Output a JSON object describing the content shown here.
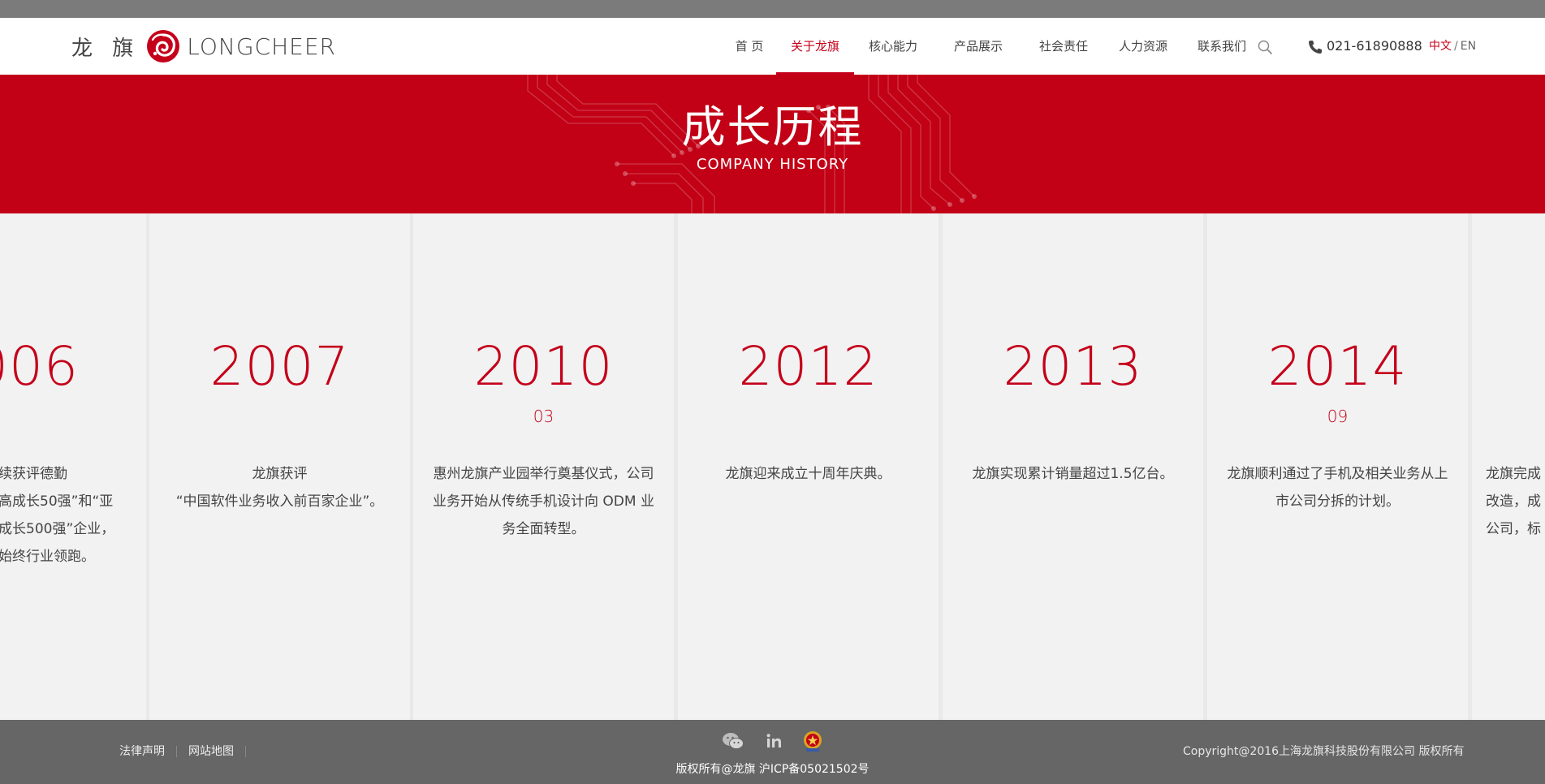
{
  "header": {
    "logo_cn": "龙 旗",
    "logo_en": "LONGCHEER",
    "nav": [
      {
        "label": "首 页"
      },
      {
        "label": "关于龙旗"
      },
      {
        "label": "核心能力"
      },
      {
        "label": "产品展示"
      },
      {
        "label": "社会责任"
      },
      {
        "label": "人力资源"
      },
      {
        "label": "联系我们"
      }
    ],
    "active_nav": "关于龙旗",
    "phone": "021-61890888",
    "lang_cn": "中文",
    "lang_sep": "/",
    "lang_en": "EN"
  },
  "banner": {
    "title": "成长历程",
    "subtitle": "COMPANY HISTORY"
  },
  "timeline": [
    {
      "year": "006",
      "month": "",
      "desc": "续获评德勤\n高成长50强”和“亚\n成长500强”企业，\n始终行业领跑。"
    },
    {
      "year": "2007",
      "month": "",
      "desc": "龙旗获评\n“中国软件业务收入前百家企业”。"
    },
    {
      "year": "2010",
      "month": "03",
      "desc": "惠州龙旗产业园举行奠基仪式，公司业务开始从传统手机设计向 ODM 业务全面转型。"
    },
    {
      "year": "2012",
      "month": "",
      "desc": "龙旗迎来成立十周年庆典。"
    },
    {
      "year": "2013",
      "month": "",
      "desc": "龙旗实现累计销量超过1.5亿台。"
    },
    {
      "year": "2014",
      "month": "09",
      "desc": "龙旗顺利通过了手机及相关业务从上市公司分拆的计划。"
    },
    {
      "year": "",
      "month": "",
      "desc": "龙旗完成\n改造，成\n公司，标"
    }
  ],
  "footer": {
    "legal": "法律声明",
    "sitemap": "网站地图",
    "icons": [
      "wechat-icon",
      "linkedin-icon",
      "police-badge-icon"
    ],
    "copyright_center": "版权所有@龙旗 沪ICP备05021502号",
    "copyright_right": "Copyright@2016上海龙旗科技股份有限公司 版权所有"
  },
  "colors": {
    "brand_red": "#c4001a",
    "banner_red": "#c20016",
    "footer_grey": "#666666",
    "panel_grey": "#f2f2f2"
  }
}
